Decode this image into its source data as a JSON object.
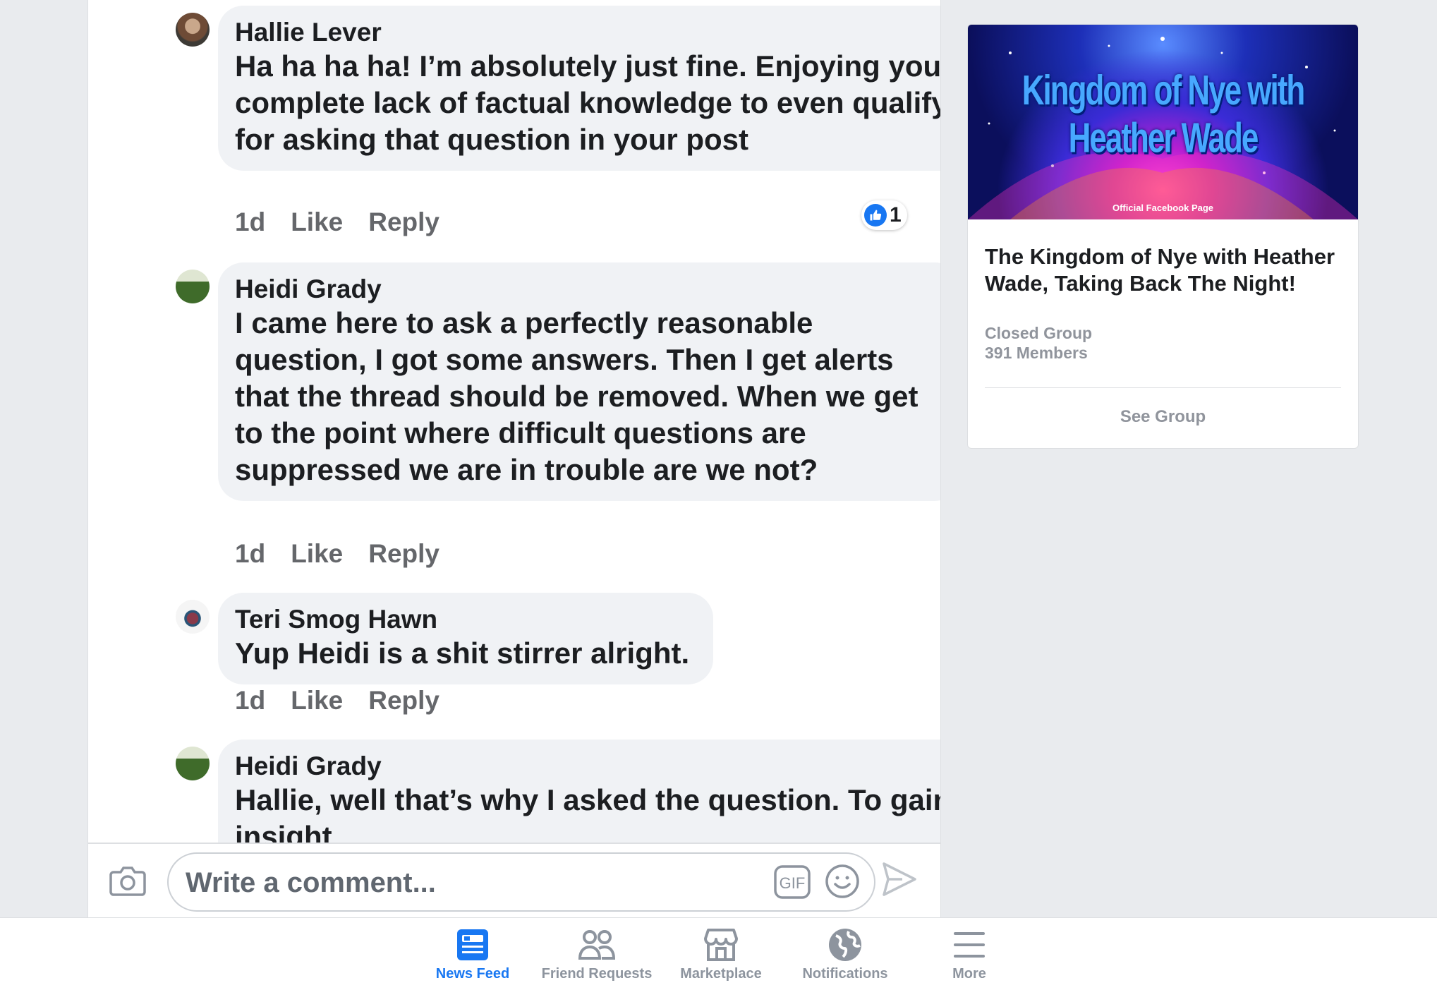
{
  "comments": [
    {
      "author": "Hallie Lever",
      "text": "Ha ha ha ha! I’m absolutely just fine. Enjoying your complete lack of factual knowledge to even qualify for asking that question in your post",
      "time": "1d",
      "like": "Like",
      "reply": "Reply",
      "reactions": "1"
    },
    {
      "author": "Heidi Grady",
      "text": "I came here to ask a perfectly reasonable question, I got some answers. Then I get alerts that the thread should be removed. When we get to the point where difficult questions are suppressed we are in trouble are we not?",
      "time": "1d",
      "like": "Like",
      "reply": "Reply"
    },
    {
      "author": "Teri Smog Hawn",
      "text": "Yup Heidi is a shit stirrer alright.",
      "time": "1d",
      "like": "Like",
      "reply": "Reply"
    },
    {
      "author": "Heidi Grady",
      "text": "Hallie, well that’s why I asked the question. To gain insight"
    }
  ],
  "composer": {
    "placeholder": "Write a comment..."
  },
  "group_card": {
    "banner_title": "Kingdom of Nye with Heather Wade",
    "banner_subtitle": "Official Facebook Page",
    "name": "The Kingdom of Nye with Heather Wade, Taking Back The Night!",
    "type": "Closed Group",
    "members": "391 Members",
    "cta": "See Group"
  },
  "tabs": [
    {
      "label": "News Feed",
      "icon": "news-feed-icon",
      "active": true
    },
    {
      "label": "Friend Requests",
      "icon": "friends-icon"
    },
    {
      "label": "Marketplace",
      "icon": "marketplace-icon"
    },
    {
      "label": "Notifications",
      "icon": "globe-icon"
    },
    {
      "label": "More",
      "icon": "menu-icon"
    }
  ],
  "colors": {
    "accent": "#1877f2",
    "bubble": "#f0f2f5",
    "muted": "#65676b"
  }
}
